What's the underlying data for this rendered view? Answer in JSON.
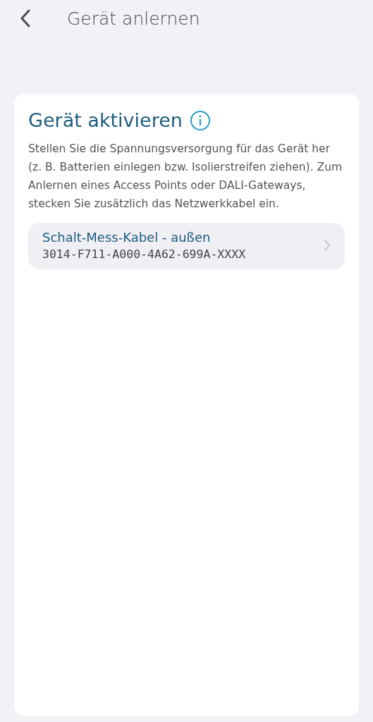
{
  "header": {
    "title": "Gerät anlernen"
  },
  "card": {
    "title": "Gerät aktivieren",
    "description": "Stellen Sie die Spannungsversorgung für das Gerät her (z. B. Batterien einlegen bzw. Isolierstreifen ziehen). Zum Anlernen eines Access Points oder DALI-Gateways, stecken Sie zusätzlich das Netzwerkkabel ein.",
    "devices": [
      {
        "name": "Schalt-Mess-Kabel - außen",
        "id": "3014-F711-A000-4A62-699A-XXXX"
      }
    ]
  }
}
